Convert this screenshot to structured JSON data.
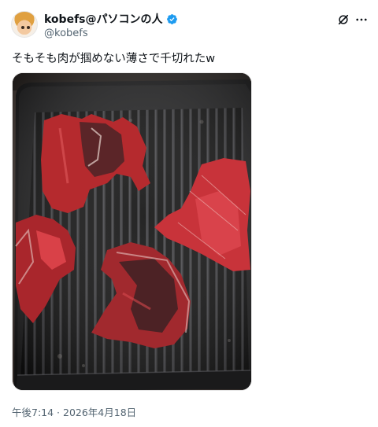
{
  "author": {
    "display_name": "kobefs@パソコンの人",
    "handle": "@kobefs",
    "verified": true
  },
  "tweet": {
    "text": "そもそも肉が掴めない薄さで千切れたw",
    "timestamp": "午後7:14 · 2026年4月18日"
  },
  "icons": {
    "verified": "verified-badge-icon",
    "grok": "grok-icon",
    "more": "more-options-icon"
  },
  "colors": {
    "verified_blue": "#1d9bf0",
    "text_primary": "#0f1419",
    "text_secondary": "#536471"
  }
}
